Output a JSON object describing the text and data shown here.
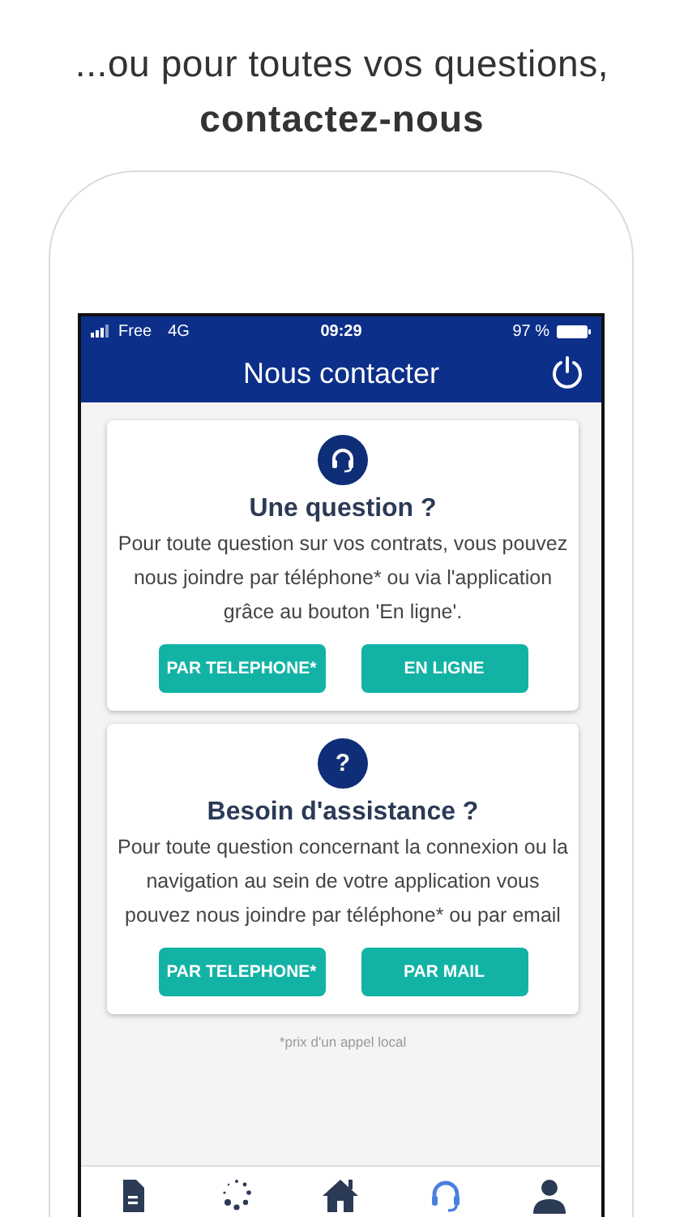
{
  "headline": {
    "line1": "...ou pour toutes vos questions,",
    "line2": "contactez-nous"
  },
  "status_bar": {
    "carrier": "Free",
    "network": "4G",
    "time": "09:29",
    "battery": "97 %"
  },
  "header": {
    "title": "Nous contacter"
  },
  "cards": [
    {
      "icon": {
        "kind": "headset"
      },
      "title": "Une question ?",
      "text": "Pour toute question sur vos contrats, vous pouvez nous joindre par téléphone* ou via l'application grâce au bouton 'En ligne'.",
      "buttons": [
        "PAR TELEPHONE*",
        "EN LIGNE"
      ]
    },
    {
      "icon": {
        "kind": "glyph",
        "glyph": "?"
      },
      "title": "Besoin d'assistance ?",
      "text": "Pour toute question concernant la connexion ou la navigation au sein de votre application vous pouvez nous joindre par téléphone* ou par email",
      "buttons": [
        "PAR TELEPHONE*",
        "PAR MAIL"
      ]
    }
  ],
  "footnote": "*prix d'un appel local",
  "nav": [
    {
      "kind": "document",
      "selected": false
    },
    {
      "kind": "spinner",
      "selected": false
    },
    {
      "kind": "home",
      "selected": false
    },
    {
      "kind": "headset",
      "selected": true
    },
    {
      "kind": "person",
      "selected": false
    }
  ]
}
